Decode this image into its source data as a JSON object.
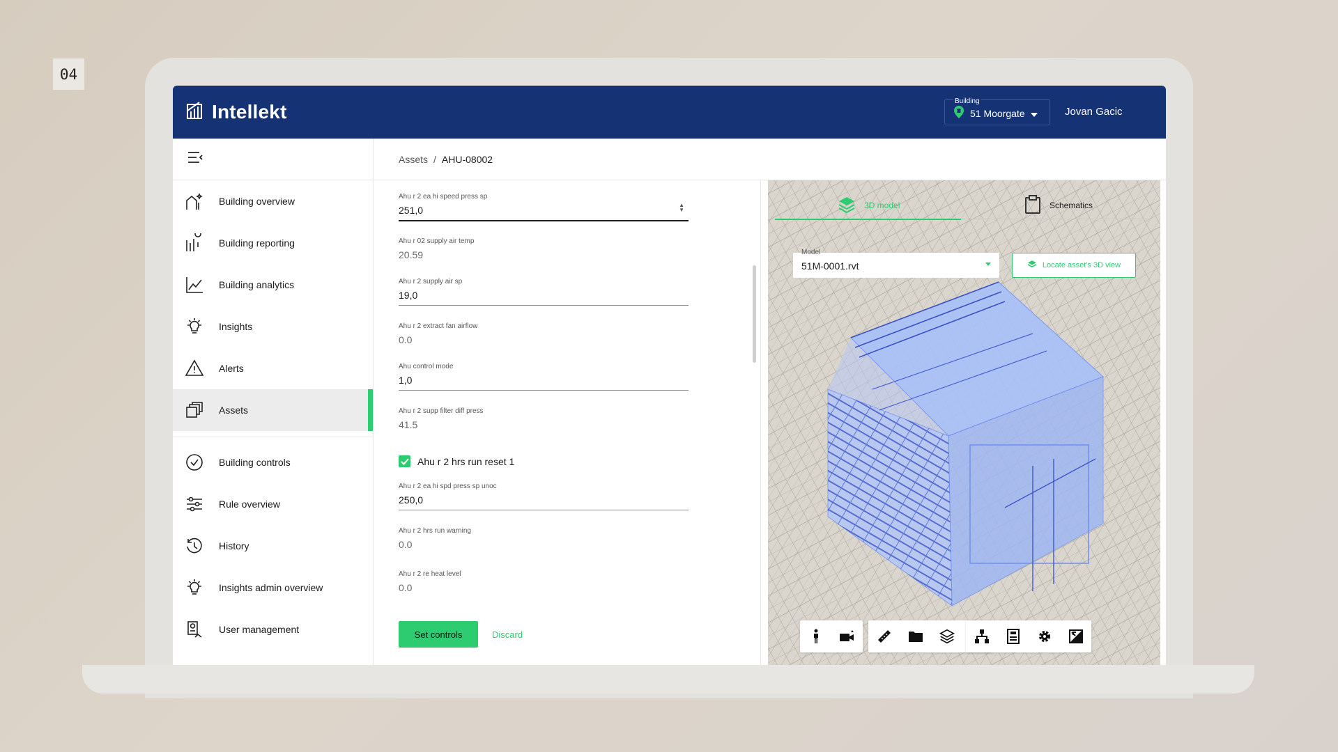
{
  "slide_number": "04",
  "app": {
    "brand": "Intellekt"
  },
  "header": {
    "building_caption": "Building",
    "building_value": "51 Moorgate",
    "user_name": "Jovan Gacic"
  },
  "sidebar": {
    "items": [
      {
        "label": "Building overview",
        "icon": "building-overview-icon"
      },
      {
        "label": "Building reporting",
        "icon": "reporting-icon"
      },
      {
        "label": "Building analytics",
        "icon": "analytics-icon"
      },
      {
        "label": "Insights",
        "icon": "lightbulb-icon"
      },
      {
        "label": "Alerts",
        "icon": "warning-icon"
      },
      {
        "label": "Assets",
        "icon": "assets-icon",
        "active": true
      }
    ],
    "admin_items": [
      {
        "label": "Building controls",
        "icon": "check-circle-icon"
      },
      {
        "label": "Rule overview",
        "icon": "sliders-icon"
      },
      {
        "label": "History",
        "icon": "history-icon"
      },
      {
        "label": "Insights admin overview",
        "icon": "lightbulb-icon"
      },
      {
        "label": "User management",
        "icon": "user-badge-icon"
      }
    ]
  },
  "breadcrumb": {
    "parent": "Assets",
    "separator": "/",
    "current": "AHU-08002"
  },
  "form": {
    "fields": [
      {
        "label": "Ahu r 2 ea hi speed press sp",
        "value": "251,0",
        "editable": true
      },
      {
        "label": "Ahu r 02 supply air temp",
        "value": "20.59",
        "editable": false
      },
      {
        "label": "Ahu r 2 supply air sp",
        "value": "19,0",
        "editable": true
      },
      {
        "label": "Ahu r 2 extract fan airflow",
        "value": "0.0",
        "editable": false
      },
      {
        "label": "Ahu control mode",
        "value": "1,0",
        "editable": true
      },
      {
        "label": "Ahu r 2 supp filter diff press",
        "value": "41.5",
        "editable": false
      }
    ],
    "checkbox": {
      "label": "Ahu r 2 hrs run reset 1",
      "checked": true
    },
    "fields_after": [
      {
        "label": "Ahu r 2 ea hi spd press sp unoc",
        "value": "250,0",
        "editable": true
      },
      {
        "label": "Ahu r 2 hrs run warning",
        "value": "0.0",
        "editable": false
      },
      {
        "label": "Ahu r 2 re heat level",
        "value": "0.0",
        "editable": false
      }
    ],
    "primary_button": "Set controls",
    "secondary_button": "Discard"
  },
  "viewer": {
    "tabs": [
      {
        "label": "3D model",
        "active": true
      },
      {
        "label": "Schematics",
        "active": false
      }
    ],
    "model_caption": "Model",
    "model_value": "51M-0001.rvt",
    "locate_button": "Locate asset's 3D view",
    "toolbar_icons": [
      [
        "walk-icon",
        "camera-icon"
      ],
      [
        "measure-icon",
        "folder-icon",
        "layers-icon",
        "explode-icon"
      ],
      [
        "hierarchy-icon",
        "properties-icon",
        "settings-icon",
        "fullscreen-icon"
      ]
    ]
  },
  "colors": {
    "header": "#153275",
    "accent": "#2ecc71",
    "model_highlight": "#6e8ff0"
  }
}
